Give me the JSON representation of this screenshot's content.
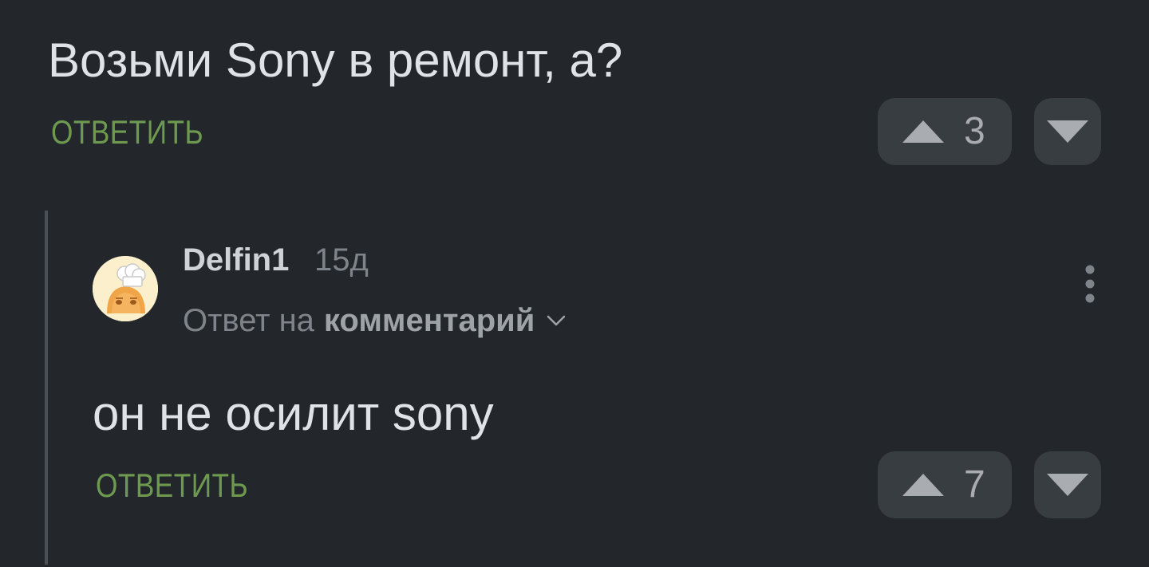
{
  "parent_comment": {
    "text": "Возьми Sony в ремонт, а?",
    "reply_label": "ОТВЕТИТЬ",
    "rating": "3",
    "upvote_icon": "triangle-up-icon",
    "downvote_icon": "triangle-down-icon"
  },
  "reply_comment": {
    "author": "Delfin1",
    "time": "15д",
    "reply_prefix": "Ответ на",
    "reply_target": "комментарий",
    "text": "он не осилит sony",
    "reply_label": "ОТВЕТИТЬ",
    "rating": "7",
    "avatar_icon": "chef-hat-avatar-icon",
    "more_icon": "more-vertical-icon",
    "expand_icon": "chevron-down-icon"
  },
  "colors": {
    "background": "#23272b",
    "accent_green": "#6d9a4f",
    "vote_bg": "#383d42",
    "text_primary": "#dfe2e6",
    "text_muted": "#7f848a"
  }
}
